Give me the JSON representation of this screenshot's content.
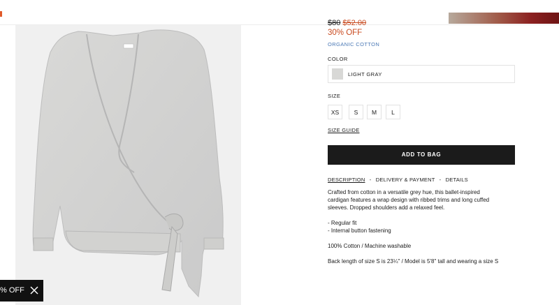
{
  "header": {
    "promo_color_from": "#b7a99c",
    "promo_color_to": "#6e1414"
  },
  "product": {
    "price_original": "$80",
    "price_sale": "$52.00",
    "discount": "30% OFF",
    "material_tag": "ORGANIC COTTON",
    "color": {
      "label": "COLOR",
      "selected": "LIGHT GRAY",
      "swatch_color": "#d8d8d6"
    },
    "size": {
      "label": "SIZE",
      "options": [
        "XS",
        "S",
        "M",
        "L"
      ],
      "guide_link": "SIZE GUIDE"
    },
    "add_to_bag": "ADD TO BAG",
    "info_tabs": {
      "description": "DESCRIPTION",
      "delivery": "DELIVERY & PAYMENT",
      "details": "DETAILS",
      "separator": "-"
    },
    "description": {
      "line1": "Crafted from cotton in a versatile grey hue, this ballet-inspired",
      "line2": "cardigan features a wrap design with ribbed trims and long cuffed",
      "line3": "sleeves. Dropped shoulders add a relaxed feel.",
      "bullet1": "- Regular fit",
      "bullet2": "- Internal button fastening",
      "composition": "100% Cotton / Machine washable",
      "fit_note": "Back length of size S is 23¼\" / Model is 5'8\" tall and wearing a size S"
    }
  },
  "popup": {
    "text": "% OFF",
    "close_icon": "close-icon"
  },
  "colors": {
    "accent_red": "#c94a1f",
    "link_blue": "#4a78b5",
    "button_black": "#1b1b1b"
  }
}
